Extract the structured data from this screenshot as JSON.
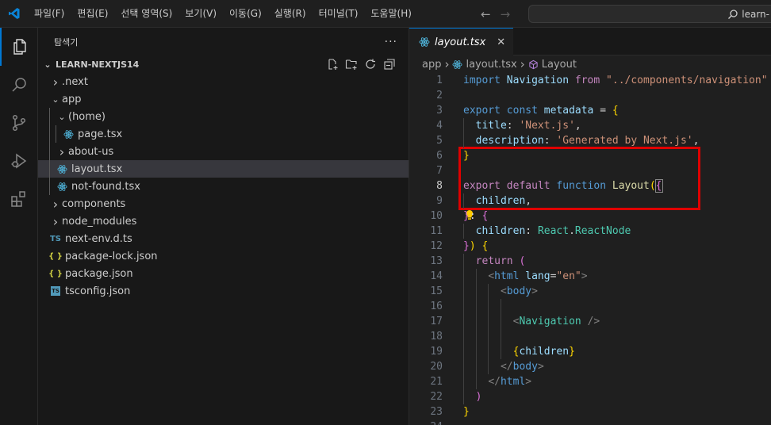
{
  "menu": [
    "파일(F)",
    "편집(E)",
    "선택 영역(S)",
    "보기(V)",
    "이동(G)",
    "실행(R)",
    "터미널(T)",
    "도움말(H)"
  ],
  "search": {
    "text": "learn-"
  },
  "sidebar": {
    "title": "탐색기",
    "more": "···",
    "project": "LEARN-NEXTJS14",
    "tree": [
      {
        "label": ".next",
        "type": "folder",
        "open": false,
        "depth": 1
      },
      {
        "label": "app",
        "type": "folder",
        "open": true,
        "depth": 1
      },
      {
        "label": "(home)",
        "type": "folder",
        "open": true,
        "depth": 2
      },
      {
        "label": "page.tsx",
        "type": "react",
        "depth": 3
      },
      {
        "label": "about-us",
        "type": "folder",
        "open": false,
        "depth": 2
      },
      {
        "label": "layout.tsx",
        "type": "react",
        "depth": 2,
        "selected": true
      },
      {
        "label": "not-found.tsx",
        "type": "react",
        "depth": 2
      },
      {
        "label": "components",
        "type": "folder",
        "open": false,
        "depth": 1
      },
      {
        "label": "node_modules",
        "type": "folder",
        "open": false,
        "depth": 1
      },
      {
        "label": "next-env.d.ts",
        "type": "ts",
        "depth": 1
      },
      {
        "label": "package-lock.json",
        "type": "json",
        "depth": 1
      },
      {
        "label": "package.json",
        "type": "json",
        "depth": 1
      },
      {
        "label": "tsconfig.json",
        "type": "tsconfig",
        "depth": 1
      }
    ]
  },
  "editor": {
    "tab": "layout.tsx",
    "breadcrumbs": [
      "app",
      "layout.tsx",
      "Layout"
    ],
    "current_line": 8,
    "lines": [
      [
        [
          "kw",
          "import"
        ],
        [
          "plain",
          " "
        ],
        [
          "var",
          "Navigation"
        ],
        [
          "plain",
          " "
        ],
        [
          "ctl",
          "from"
        ],
        [
          "plain",
          " "
        ],
        [
          "str",
          "\"../components/navigation\""
        ]
      ],
      [],
      [
        [
          "kw",
          "export"
        ],
        [
          "plain",
          " "
        ],
        [
          "kw",
          "const"
        ],
        [
          "plain",
          " "
        ],
        [
          "var",
          "metadata"
        ],
        [
          "plain",
          " = "
        ],
        [
          "br1",
          "{"
        ]
      ],
      [
        [
          "plain",
          "  "
        ],
        [
          "var",
          "title"
        ],
        [
          "plain",
          ": "
        ],
        [
          "str",
          "'Next.js'"
        ],
        [
          "plain",
          ","
        ]
      ],
      [
        [
          "plain",
          "  "
        ],
        [
          "var",
          "description"
        ],
        [
          "plain",
          ": "
        ],
        [
          "str",
          "'Generated by Next.js'"
        ],
        [
          "plain",
          ","
        ]
      ],
      [
        [
          "br1",
          "}"
        ]
      ],
      [],
      [
        [
          "ctl",
          "export"
        ],
        [
          "plain",
          " "
        ],
        [
          "ctl",
          "default"
        ],
        [
          "plain",
          " "
        ],
        [
          "kw",
          "function"
        ],
        [
          "plain",
          " "
        ],
        [
          "fn",
          "Layout"
        ],
        [
          "br1",
          "("
        ],
        [
          "br2",
          "{"
        ]
      ],
      [
        [
          "plain",
          "  "
        ],
        [
          "var",
          "children"
        ],
        [
          "plain",
          ","
        ]
      ],
      [
        [
          "br2",
          "}"
        ],
        [
          "plain",
          ": "
        ],
        [
          "br2",
          "{"
        ]
      ],
      [
        [
          "plain",
          "  "
        ],
        [
          "var",
          "children"
        ],
        [
          "plain",
          ": "
        ],
        [
          "cls",
          "React"
        ],
        [
          "plain",
          "."
        ],
        [
          "cls",
          "ReactNode"
        ]
      ],
      [
        [
          "br2",
          "}"
        ],
        [
          "br1",
          ")"
        ],
        [
          "plain",
          " "
        ],
        [
          "br1",
          "{"
        ]
      ],
      [
        [
          "plain",
          "  "
        ],
        [
          "ctl",
          "return"
        ],
        [
          "plain",
          " "
        ],
        [
          "br2",
          "("
        ]
      ],
      [
        [
          "plain",
          "    "
        ],
        [
          "ang",
          "<"
        ],
        [
          "tag",
          "html"
        ],
        [
          "plain",
          " "
        ],
        [
          "var",
          "lang"
        ],
        [
          "plain",
          "="
        ],
        [
          "str",
          "\"en\""
        ],
        [
          "ang",
          ">"
        ]
      ],
      [
        [
          "plain",
          "      "
        ],
        [
          "ang",
          "<"
        ],
        [
          "tag",
          "body"
        ],
        [
          "ang",
          ">"
        ]
      ],
      [],
      [
        [
          "plain",
          "        "
        ],
        [
          "ang",
          "<"
        ],
        [
          "cls",
          "Navigation"
        ],
        [
          "plain",
          " "
        ],
        [
          "ang",
          "/>"
        ]
      ],
      [],
      [
        [
          "plain",
          "        "
        ],
        [
          "br1",
          "{"
        ],
        [
          "var",
          "children"
        ],
        [
          "br1",
          "}"
        ]
      ],
      [
        [
          "plain",
          "      "
        ],
        [
          "ang",
          "</"
        ],
        [
          "tag",
          "body"
        ],
        [
          "ang",
          ">"
        ]
      ],
      [
        [
          "plain",
          "    "
        ],
        [
          "ang",
          "</"
        ],
        [
          "tag",
          "html"
        ],
        [
          "ang",
          ">"
        ]
      ],
      [
        [
          "plain",
          "  "
        ],
        [
          "br2",
          ")"
        ]
      ],
      [
        [
          "br1",
          "}"
        ]
      ],
      []
    ]
  },
  "colors": {
    "accent": "#0078d4",
    "highlight": "#e00000",
    "selected_row": "#37373d"
  }
}
